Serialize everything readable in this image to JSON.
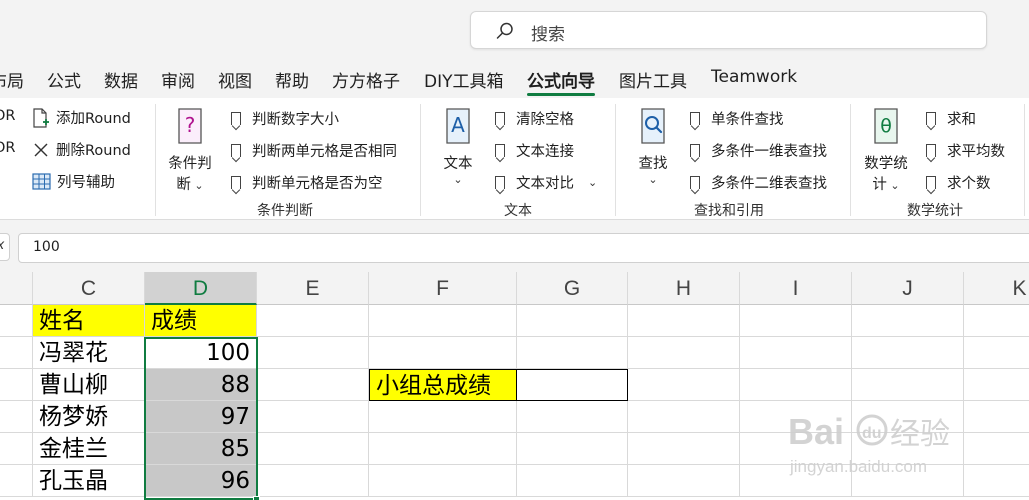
{
  "search": {
    "placeholder": "搜索"
  },
  "tabs": [
    {
      "label": "布局",
      "active": false
    },
    {
      "label": "公式",
      "active": false
    },
    {
      "label": "数据",
      "active": false
    },
    {
      "label": "审阅",
      "active": false
    },
    {
      "label": "视图",
      "active": false
    },
    {
      "label": "帮助",
      "active": false
    },
    {
      "label": "方方格子",
      "active": false
    },
    {
      "label": "DIY工具箱",
      "active": false
    },
    {
      "label": "公式向导",
      "active": true
    },
    {
      "label": "图片工具",
      "active": false
    },
    {
      "label": "Teamwork",
      "active": false
    }
  ],
  "ribbon": {
    "cut_left": [
      "OR",
      "OR"
    ],
    "round": {
      "add": "添加Round",
      "delete": "删除Round",
      "col_helper": "列号辅助"
    },
    "condition": {
      "big_label_1": "条件判",
      "big_label_2": "断",
      "items": [
        "判断数字大小",
        "判断两单元格是否相同",
        "判断单元格是否为空"
      ],
      "group": "条件判断"
    },
    "text": {
      "big_label": "文本",
      "items": [
        "清除空格",
        "文本连接",
        "文本对比"
      ],
      "group": "文本"
    },
    "lookup": {
      "big_label": "查找",
      "items": [
        "单条件查找",
        "多条件一维表查找",
        "多条件二维表查找"
      ],
      "group": "查找和引用"
    },
    "math": {
      "big_label_1": "数学统",
      "big_label_2": "计",
      "items": [
        "求和",
        "求平均数",
        "求个数"
      ],
      "group": "数学统计"
    }
  },
  "formula_bar": {
    "fx_label": "fx",
    "value": "100"
  },
  "columns": [
    "C",
    "D",
    "E",
    "F",
    "G",
    "H",
    "I",
    "J",
    "K"
  ],
  "sheet": {
    "header_name": "姓名",
    "header_score": "成绩",
    "rows": [
      {
        "name": "冯翠花",
        "score": "100"
      },
      {
        "name": "曹山柳",
        "score": "88"
      },
      {
        "name": "杨梦娇",
        "score": "97"
      },
      {
        "name": "金桂兰",
        "score": "85"
      },
      {
        "name": "孔玉晶",
        "score": "96"
      }
    ],
    "total_label": "小组总成绩",
    "total_value": ""
  },
  "watermark": {
    "brand": "Baidu经验",
    "url": "jingyan.baidu.com"
  },
  "colors": {
    "accent": "#107c41",
    "highlight": "#ffff00",
    "selected_fill": "#c8c8c8"
  }
}
